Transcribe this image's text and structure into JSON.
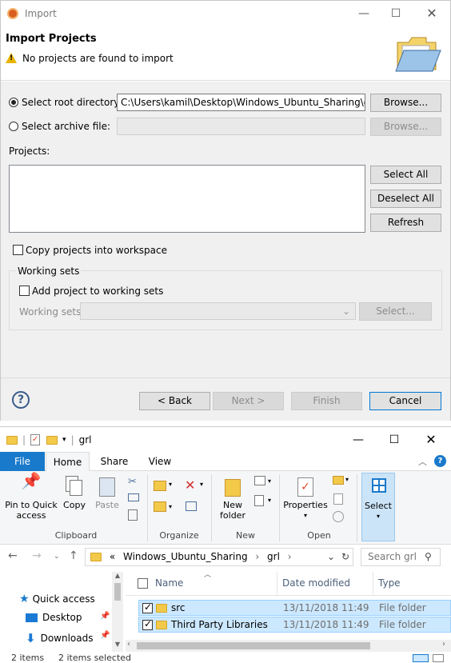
{
  "dialog": {
    "title": "Import",
    "header_title": "Import Projects",
    "header_message": "No projects are found to import",
    "root_dir_label": "Select root directory:",
    "root_dir_value": "C:\\Users\\kamil\\Desktop\\Windows_Ubuntu_Sharing\\grl",
    "archive_label": "Select archive file:",
    "browse_label": "Browse...",
    "browse2_label": "Browse...",
    "projects_label": "Projects:",
    "select_all": "Select All",
    "deselect_all": "Deselect All",
    "refresh": "Refresh",
    "copy_label": "Copy projects into workspace",
    "working_sets_group": "Working sets",
    "add_ws_label": "Add project to working sets",
    "ws_label": "Working sets:",
    "ws_select": "Select...",
    "back": "< Back",
    "next": "Next >",
    "finish": "Finish",
    "cancel": "Cancel",
    "root_selected": true,
    "copy_checked": false,
    "add_ws_checked": false
  },
  "explorer": {
    "title": "grl",
    "tabs": [
      "File",
      "Home",
      "Share",
      "View"
    ],
    "active_tab": "Home",
    "ribbon": {
      "pin": "Pin to Quick access",
      "pin_l1": "Pin to Quick",
      "pin_l2": "access",
      "copy": "Copy",
      "paste": "Paste",
      "clipboard": "Clipboard",
      "organize": "Organize",
      "newfolder_l1": "New",
      "newfolder_l2": "folder",
      "new": "New",
      "properties": "Properties",
      "open": "Open",
      "select": "Select"
    },
    "breadcrumb": [
      "«",
      "Windows_Ubuntu_Sharing",
      "grl"
    ],
    "search_placeholder": "Search grl",
    "nav_items": [
      "Quick access",
      "Desktop",
      "Downloads"
    ],
    "columns": [
      "Name",
      "Date modified",
      "Type"
    ],
    "rows": [
      {
        "name": "src",
        "date": "13/11/2018 11:49",
        "type": "File folder",
        "checked": true
      },
      {
        "name": "Third Party Libraries",
        "date": "13/11/2018 11:49",
        "type": "File folder",
        "checked": true
      }
    ],
    "status_items": "2 items",
    "status_selected": "2 items selected"
  },
  "colors": {
    "accent": "#0078d7",
    "file_tab": "#1979ca",
    "selection": "#cce8ff",
    "folder": "#f3c94a"
  }
}
